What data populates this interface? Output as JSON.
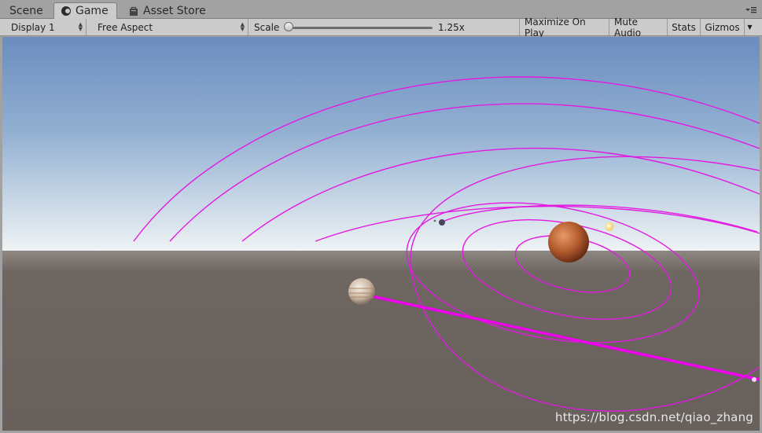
{
  "tabs": {
    "scene": "Scene",
    "game": "Game",
    "asset_store": "Asset Store"
  },
  "toolbar": {
    "display": "Display 1",
    "aspect": "Free Aspect",
    "scale_label": "Scale",
    "scale_value": "1.25x",
    "scale_level": 0.0,
    "maximize_on_play": "Maximize On Play",
    "mute_audio": "Mute Audio",
    "stats": "Stats",
    "gizmos": "Gizmos"
  },
  "watermark": "https://blog.csdn.net/qiao_zhang",
  "colors": {
    "orbit": "#e21ae2",
    "sky_top": "#6d8fc0",
    "horizon": "#dfe6ec",
    "ground": "#6b635e"
  }
}
